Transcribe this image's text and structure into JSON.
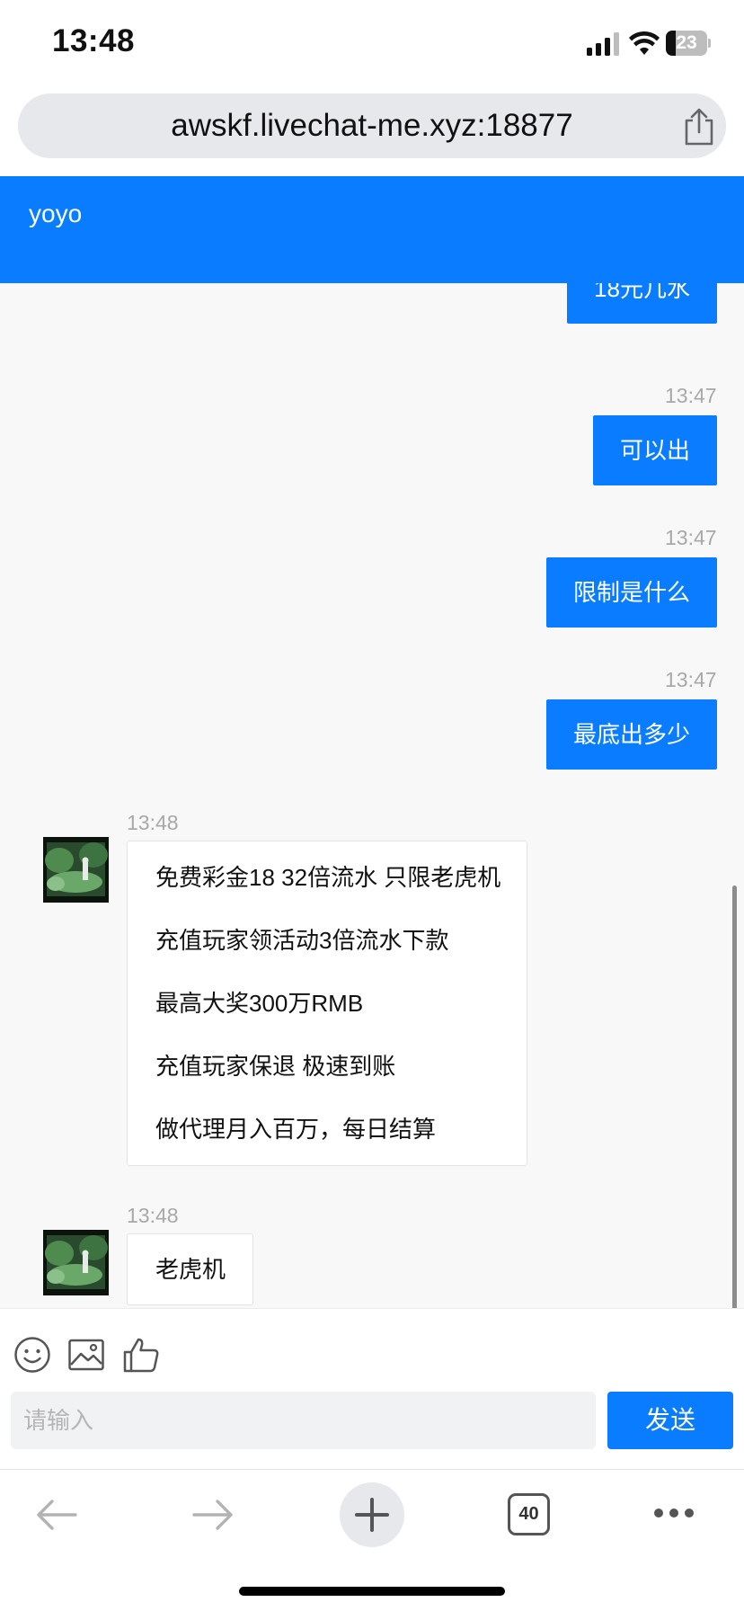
{
  "status_bar": {
    "time": "13:48",
    "battery_level": "23",
    "battery_fraction": 0.23,
    "icons": [
      "signal-icon",
      "wifi-icon",
      "battery-icon"
    ]
  },
  "browser": {
    "url": "awskf.livechat-me.xyz:18877",
    "share_icon": "share-icon",
    "tab_count": "40",
    "nav_icons": [
      "back-arrow-icon",
      "forward-arrow-icon",
      "plus-icon",
      "tabs-icon",
      "more-icon"
    ]
  },
  "chat": {
    "title": "yoyo",
    "accent_color": "#0a7cff",
    "messages": [
      {
        "side": "out",
        "time": "",
        "text": "18元几水"
      },
      {
        "side": "out",
        "time": "13:47",
        "text": "可以出"
      },
      {
        "side": "out",
        "time": "13:47",
        "text": "限制是什么"
      },
      {
        "side": "out",
        "time": "13:47",
        "text": "最底出多少"
      },
      {
        "side": "in",
        "time": "13:48",
        "lines": [
          "免费彩金18 32倍流水 只限老虎机",
          "充值玩家领活动3倍流水下款",
          "最高大奖300万RMB",
          "充值玩家保退 极速到账",
          "做代理月入百万，每日结算"
        ]
      },
      {
        "side": "in",
        "time": "13:48",
        "lines": [
          "老虎机"
        ]
      }
    ]
  },
  "composer": {
    "tools": [
      "emoji-icon",
      "image-icon",
      "thumbs-up-icon"
    ],
    "input_placeholder": "请输入",
    "input_value": "",
    "send_label": "发送"
  }
}
